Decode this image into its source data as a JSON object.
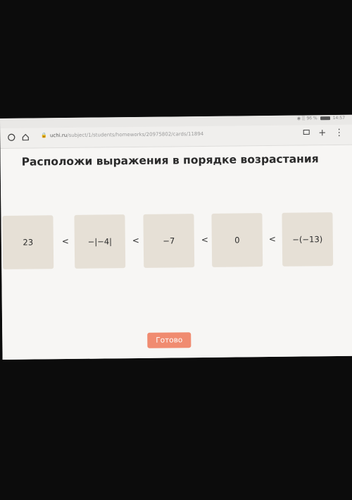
{
  "status": {
    "signal": "◉ ░ 96 %",
    "time": "14:57"
  },
  "browser": {
    "url_domain": "uchi.ru",
    "url_path": "/subject/1/students/homeworks/20975802/cards/11894",
    "back_icon": "circle-back-icon",
    "home_icon": "home-icon",
    "tabs_icon": "tabs-icon",
    "plus": "+",
    "menu": "⋮"
  },
  "task": {
    "title": "Расположи выражения в порядке возрастания",
    "cards": [
      "23",
      "−|−4|",
      "−7",
      "0",
      "−(−13)"
    ],
    "separator": "<",
    "done_label": "Готово"
  },
  "colors": {
    "card_bg": "#e6e0d6",
    "button_bg": "#f08b70",
    "page_bg": "#f7f6f4"
  }
}
